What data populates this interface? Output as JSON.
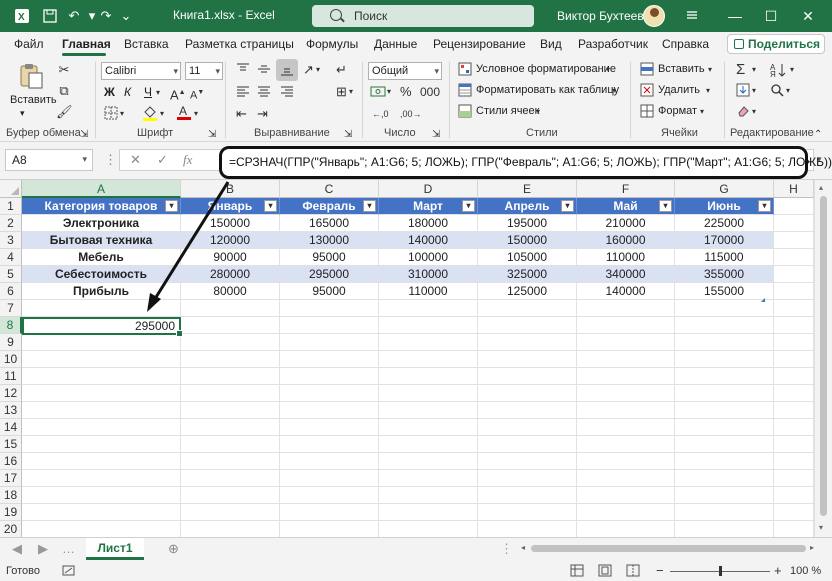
{
  "titlebar": {
    "doc_title": "Книга1.xlsx  -  Excel",
    "search_placeholder": "Поиск",
    "user_name": "Виктор Бухтеев",
    "minimize": "—",
    "maximize": "☐",
    "close": "✕"
  },
  "tabs": [
    "Файл",
    "Главная",
    "Вставка",
    "Разметка страницы",
    "Формулы",
    "Данные",
    "Рецензирование",
    "Вид",
    "Разработчик",
    "Справка"
  ],
  "share_label": "Поделиться",
  "ribbon": {
    "clipboard": {
      "paste": "Вставить",
      "label": "Буфер обмена"
    },
    "font": {
      "name": "Calibri",
      "size": "11",
      "label": "Шрифт",
      "bold": "Ж",
      "italic": "К",
      "underline": "Ч"
    },
    "alignment": {
      "label": "Выравнивание"
    },
    "number": {
      "format": "Общий",
      "label": "Число"
    },
    "styles": {
      "conditional": "Условное форматирование",
      "as_table": "Форматировать как таблицу",
      "cell_styles": "Стили ячеек",
      "label": "Стили"
    },
    "cells": {
      "insert": "Вставить",
      "delete": "Удалить",
      "format": "Формат",
      "label": "Ячейки"
    },
    "editing": {
      "label": "Редактирование"
    }
  },
  "formula_bar": {
    "name_box": "A8",
    "formula": "=СРЗНАЧ(ГПР(\"Январь\"; A1:G6; 5; ЛОЖЬ); ГПР(\"Февраль\"; A1:G6; 5; ЛОЖЬ); ГПР(\"Март\"; A1:G6; 5; ЛОЖЬ))"
  },
  "columns": [
    "A",
    "B",
    "C",
    "D",
    "E",
    "F",
    "G",
    "H"
  ],
  "rows": [
    "1",
    "2",
    "3",
    "4",
    "5",
    "6",
    "7",
    "8",
    "9",
    "10",
    "11",
    "12",
    "13",
    "14",
    "15",
    "16",
    "17",
    "18",
    "19",
    "20"
  ],
  "table": {
    "headers": [
      "Категория товаров",
      "Январь",
      "Февраль",
      "Март",
      "Апрель",
      "Май",
      "Июнь"
    ],
    "rows": [
      [
        "Электроника",
        "150000",
        "165000",
        "180000",
        "195000",
        "210000",
        "225000"
      ],
      [
        "Бытовая техника",
        "120000",
        "130000",
        "140000",
        "150000",
        "160000",
        "170000"
      ],
      [
        "Мебель",
        "90000",
        "95000",
        "100000",
        "105000",
        "110000",
        "115000"
      ],
      [
        "Себестоимость",
        "280000",
        "295000",
        "310000",
        "325000",
        "340000",
        "355000"
      ],
      [
        "Прибыль",
        "80000",
        "95000",
        "110000",
        "125000",
        "140000",
        "155000"
      ]
    ]
  },
  "active_cell_value": "295000",
  "sheet_tab": "Лист1",
  "status": {
    "ready": "Готово",
    "zoom": "100 %"
  },
  "colors": {
    "excel_green": "#217346",
    "table_header": "#4472c4",
    "table_band": "#d9e1f2"
  }
}
